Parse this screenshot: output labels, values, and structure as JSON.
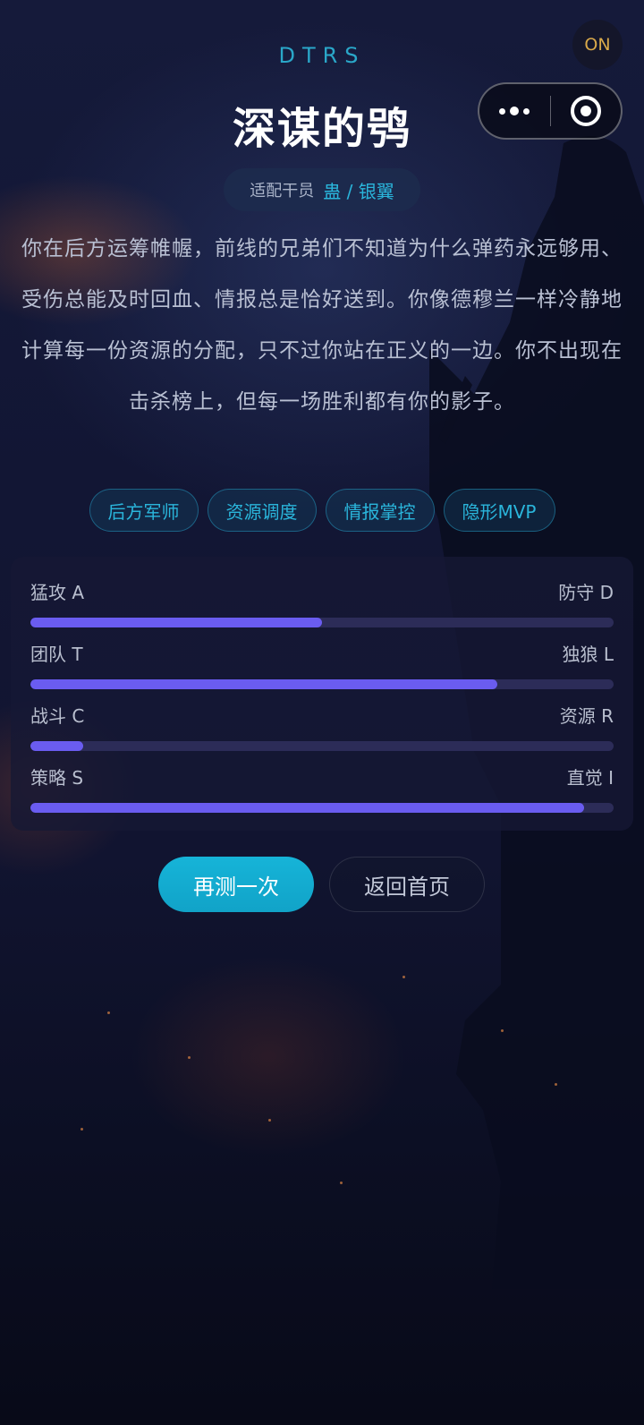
{
  "brand": "DTRS",
  "status_badge": "ON",
  "title": "深谋的鸮",
  "agent": {
    "label": "适配干员",
    "value": "蛊 / 银翼"
  },
  "description": "你在后方运筹帷幄，前线的兄弟们不知道为什么弹药永远够用、受伤总能及时回血、情报总是恰好送到。你像德穆兰一样冷静地计算每一份资源的分配，只不过你站在正义的一边。你不出现在击杀榜上，但每一场胜利都有你的影子。",
  "tags": [
    "后方军师",
    "资源调度",
    "情报掌控",
    "隐形MVP"
  ],
  "dimensions": [
    {
      "left": "猛攻 A",
      "right": "防守 D",
      "value": 0.5
    },
    {
      "left": "团队 T",
      "right": "独狼 L",
      "value": 0.8
    },
    {
      "left": "战斗 C",
      "right": "资源 R",
      "value": 0.09
    },
    {
      "left": "策略 S",
      "right": "直觉 I",
      "value": 0.95
    }
  ],
  "buttons": {
    "retry": "再测一次",
    "home": "返回首页"
  },
  "colors": {
    "accent": "#2ab5db",
    "bar_fill": "#6a5cf0",
    "bar_track": "#2c2c58",
    "badge": "#d9a94a"
  }
}
